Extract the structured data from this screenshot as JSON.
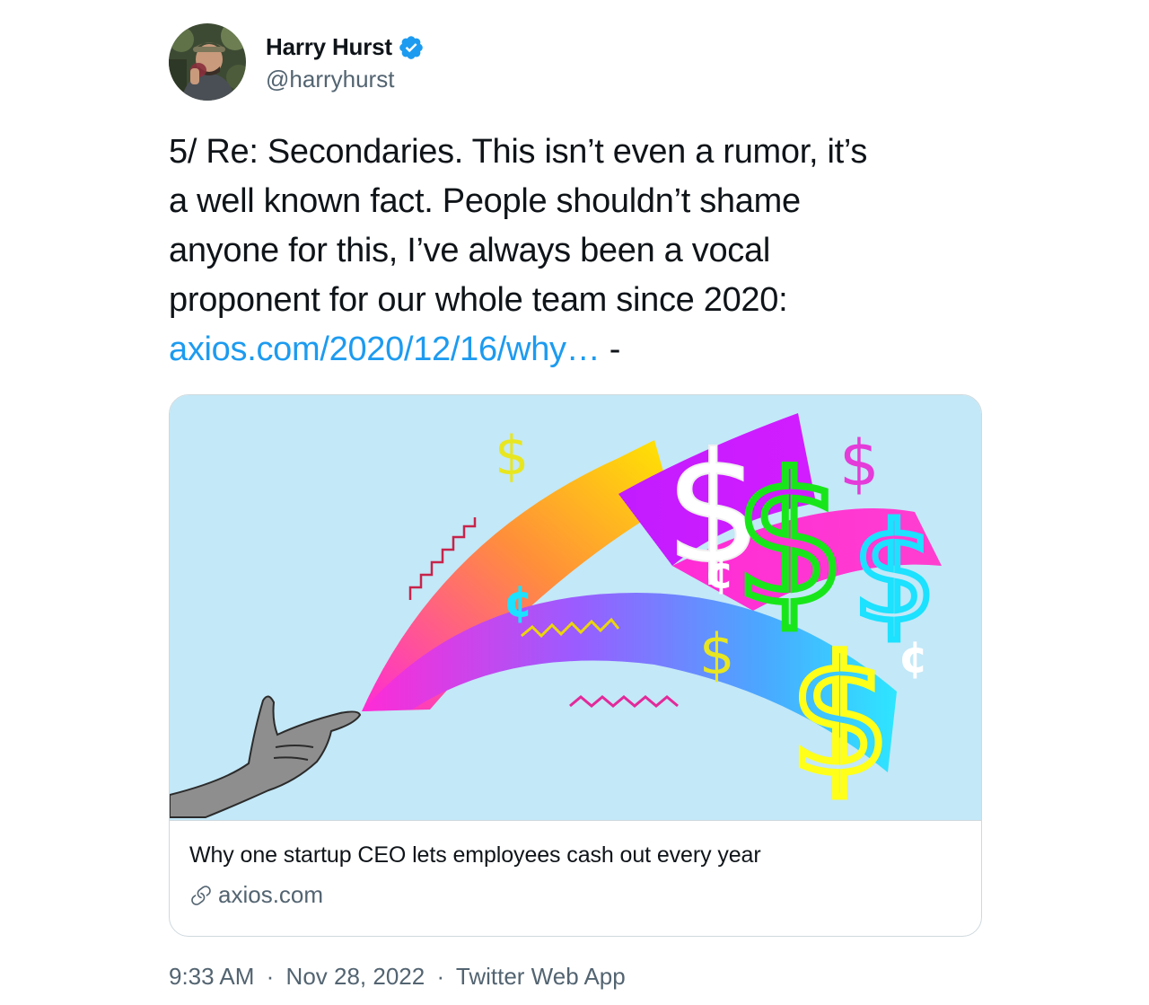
{
  "author": {
    "display_name": "Harry Hurst",
    "handle": "@harryhurst",
    "verified": true,
    "verified_color": "#1d9bf0"
  },
  "tweet": {
    "lines": [
      "5/ Re: Secondaries. This isn’t even a rumor, it’s",
      "a well known fact. People shouldn’t shame",
      "anyone for this, I’ve always been a vocal",
      "proponent for our whole team since 2020:"
    ],
    "link_text": "axios.com/2020/12/16/why…",
    "trailing_text": " -"
  },
  "card": {
    "title": "Why one startup CEO lets employees cash out every year",
    "domain": "axios.com",
    "image_background": "#c3e8f7"
  },
  "meta": {
    "time": "9:33 AM",
    "date": "Nov 28, 2022",
    "source": "Twitter Web App",
    "separator": "·"
  },
  "colors": {
    "text": "#0f1419",
    "secondary": "#536471",
    "link": "#1d9bf0",
    "border": "#cfd9de"
  }
}
